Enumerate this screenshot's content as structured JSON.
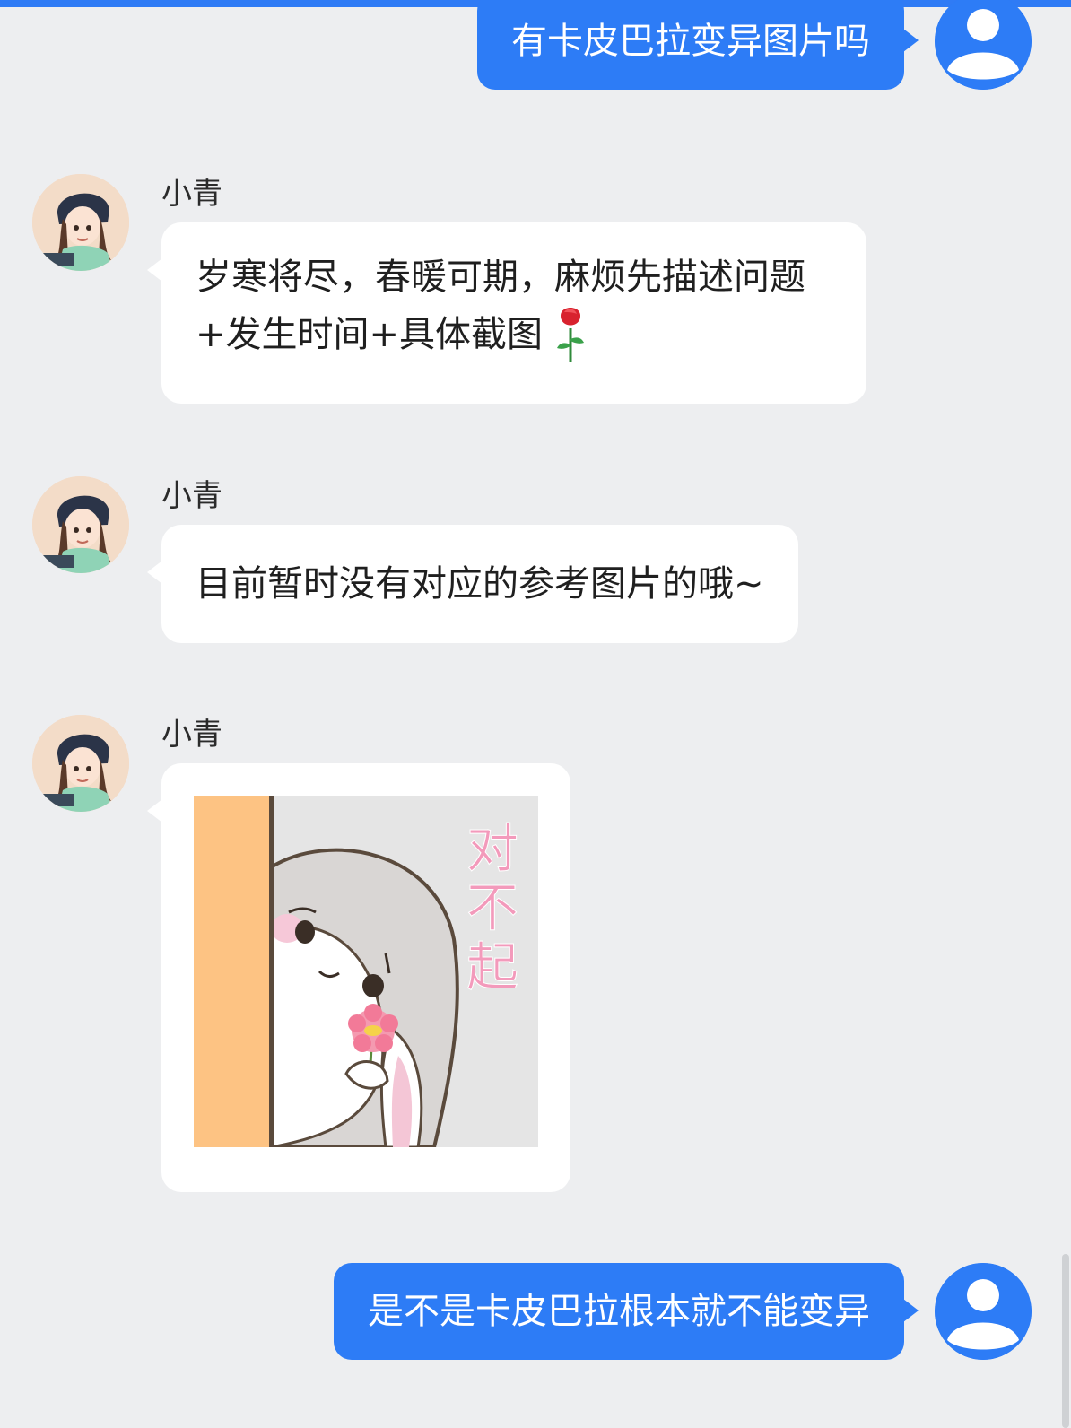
{
  "messages": {
    "user_1": {
      "text": "有卡皮巴拉变异图片吗"
    },
    "agent_1": {
      "name": "小青",
      "line1": "岁寒将尽，春暖可期，麻烦先描述问题",
      "line2": "+发生时间+具体截图",
      "emoji": "rose"
    },
    "agent_2": {
      "name": "小青",
      "text": "目前暂时没有对应的参考图片的哦~"
    },
    "agent_3": {
      "name": "小青",
      "sticker_text": "对不起"
    },
    "user_2": {
      "text": "是不是卡皮巴拉根本就不能变异"
    }
  },
  "colors": {
    "accent": "#2d7cf6",
    "background": "#edeef0",
    "agent_bubble": "#ffffff"
  },
  "icons": {
    "user_avatar": "person-icon",
    "agent_avatar": "girl-avatar",
    "emoji": "rose-icon"
  }
}
